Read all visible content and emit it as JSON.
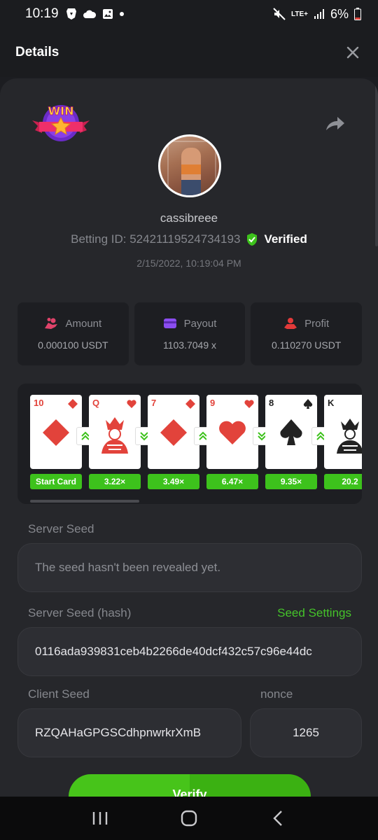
{
  "status_bar": {
    "time": "10:19",
    "network": "LTE+",
    "battery": "6%",
    "icons_left": [
      "brave-lion-icon",
      "cloud-icon",
      "image-icon",
      "dot-icon"
    ],
    "icons_right": [
      "mute-icon",
      "lte-icon",
      "signal-icon",
      "battery-low-icon"
    ]
  },
  "header": {
    "title": "Details",
    "close_icon": "close-icon"
  },
  "bet": {
    "badge_text": "WIN",
    "username": "cassibreee",
    "betting_id": "Betting ID: 52421119524734193",
    "verified_label": "Verified",
    "timestamp": "2/15/2022, 10:19:04 PM"
  },
  "stats": [
    {
      "label": "Amount",
      "value": "0.000100 USDT",
      "icon": "coins-hand-icon",
      "color": "#e0436a"
    },
    {
      "label": "Payout",
      "value": "1103.7049 x",
      "icon": "wallet-icon",
      "color": "#8b4df0"
    },
    {
      "label": "Profit",
      "value": "0.110270 USDT",
      "icon": "profit-hand-icon",
      "color": "#e23a3a"
    }
  ],
  "cards": [
    {
      "rank": "10",
      "suit": "diamond",
      "mult": "Start Card"
    },
    {
      "rank": "Q",
      "suit": "heart",
      "mult": "3.22×",
      "dir": "up"
    },
    {
      "rank": "7",
      "suit": "diamond",
      "mult": "3.49×",
      "dir": "down"
    },
    {
      "rank": "9",
      "suit": "heart",
      "mult": "6.47×",
      "dir": "up"
    },
    {
      "rank": "8",
      "suit": "spade",
      "mult": "9.35×",
      "dir": "down"
    },
    {
      "rank": "K",
      "suit": "spade",
      "mult": "20.2",
      "dir": "up"
    }
  ],
  "fields": {
    "server_seed_label": "Server Seed",
    "server_seed_value": "The seed hasn't been revealed yet.",
    "server_seed_hash_label": "Server Seed (hash)",
    "seed_settings": "Seed Settings",
    "server_seed_hash_value": "0116ada939831ceb4b2266de40dcf432c57c96e44dc",
    "client_seed_label": "Client Seed",
    "client_seed_value": "RZQAHaGPGSCdhpnwrkrXmB",
    "nonce_label": "nonce",
    "nonce_value": "1265"
  },
  "verify_button": "Verify",
  "nav": {
    "recent": "recents-icon",
    "home": "home-icon",
    "back": "back-icon"
  },
  "colors": {
    "accent_green": "#45c32a",
    "background": "#1c1d21",
    "sheet": "#26272b"
  }
}
